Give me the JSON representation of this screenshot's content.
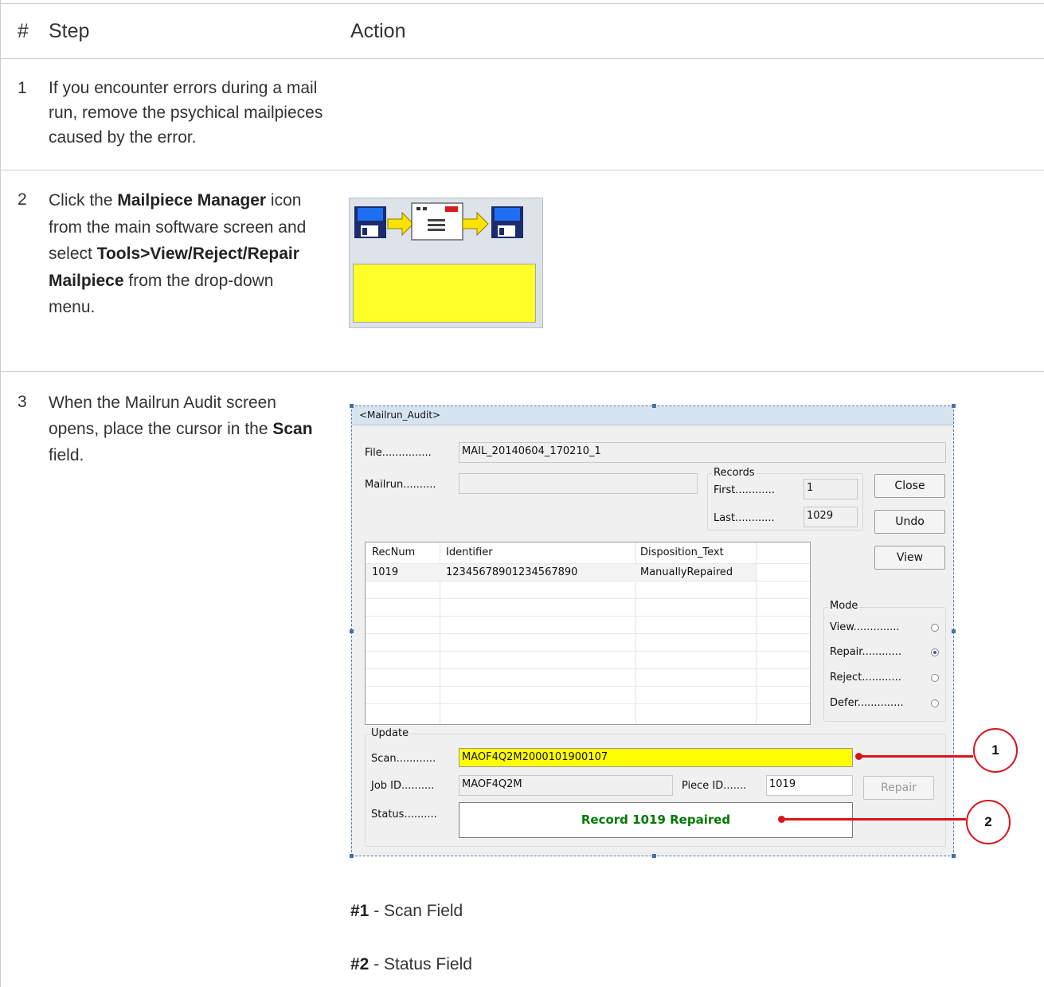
{
  "table": {
    "headers": {
      "num": "#",
      "step": "Step",
      "action": "Action"
    },
    "rows": [
      {
        "num": "1",
        "step_text": "If you encounter errors during a mail run, remove the psychical mailpieces caused by the error."
      },
      {
        "num": "2",
        "step_parts": [
          "Click the ",
          "Mailpiece Manager",
          " icon from the main software screen and select ",
          "Tools>View/Reject/Repair Mailpiece",
          " from the drop-down menu."
        ]
      },
      {
        "num": "3",
        "step_parts": [
          "When the Mailrun Audit screen opens, place the cursor in the ",
          "Scan",
          " field."
        ]
      }
    ]
  },
  "dialog": {
    "title": "<Mailrun_Audit>",
    "file_label": "File",
    "file_value": "MAIL_20140604_170210_1",
    "mailrun_label": "Mailrun",
    "mailrun_value": "",
    "records_caption": "Records",
    "first_label": "First",
    "first_value": "1",
    "last_label": "Last",
    "last_value": "1029",
    "close_button": "Close",
    "undo_button": "Undo",
    "view_button": "View",
    "grid_headers": [
      "RecNum",
      "Identifier",
      "Disposition_Text"
    ],
    "grid_rows": [
      [
        "1019",
        "12345678901234567890",
        "ManuallyRepaired"
      ]
    ],
    "mode_caption": "Mode",
    "modes": [
      {
        "label": "View",
        "selected": false
      },
      {
        "label": "Repair",
        "selected": true
      },
      {
        "label": "Reject",
        "selected": false
      },
      {
        "label": "Defer",
        "selected": false
      }
    ],
    "update_caption": "Update",
    "scan_label": "Scan",
    "scan_value": "MAOF4Q2M2000101900107",
    "jobid_label": "Job ID",
    "jobid_value": "MAOF4Q2M",
    "pieceid_label": "Piece ID",
    "pieceid_value": "1019",
    "repair_button": "Repair",
    "status_label": "Status",
    "status_value": "Record 1019 Repaired"
  },
  "callouts": [
    {
      "num": "1",
      "note_bold": "#1",
      "note_text": " - Scan Field"
    },
    {
      "num": "2",
      "note_bold": "#2",
      "note_text": " - Status Field"
    }
  ],
  "colors": {
    "callout": "#d8141c",
    "scan_highlight": "#ffff00",
    "status_text": "#007a00",
    "icon_yellow": "#ffff29"
  }
}
